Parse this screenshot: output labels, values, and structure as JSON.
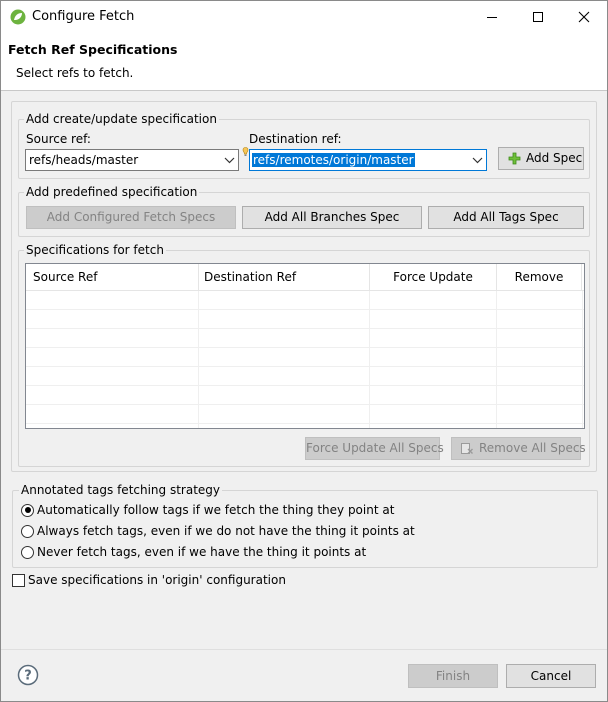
{
  "window": {
    "title": "Configure Fetch"
  },
  "header": {
    "title": "Fetch Ref Specifications",
    "subtitle": "Select refs to fetch."
  },
  "create_spec": {
    "group_label": "Add create/update specification",
    "source_label": "Source ref:",
    "source_value": "refs/heads/master",
    "dest_label": "Destination ref:",
    "dest_value": "refs/remotes/origin/master",
    "add_spec_label": "Add Spec"
  },
  "predefined": {
    "group_label": "Add predefined specification",
    "configured_label": "Add Configured Fetch Specs",
    "branches_label": "Add All Branches Spec",
    "tags_label": "Add All Tags Spec"
  },
  "specs": {
    "group_label": "Specifications for fetch",
    "columns": [
      "Source Ref",
      "Destination Ref",
      "Force Update",
      "Remove"
    ],
    "force_update_all_label": "Force Update All Specs",
    "remove_all_label": "Remove All Specs"
  },
  "tags_strategy": {
    "group_label": "Annotated tags fetching strategy",
    "options": [
      {
        "label": "Automatically follow tags if we fetch the thing they point at",
        "checked": true
      },
      {
        "label": "Always fetch tags, even if we do not have the thing it points at",
        "checked": false
      },
      {
        "label": "Never fetch tags, even if we have the thing it points at",
        "checked": false
      }
    ]
  },
  "save_config": {
    "label": "Save specifications in 'origin' configuration",
    "checked": false
  },
  "footer": {
    "finish_label": "Finish",
    "cancel_label": "Cancel"
  },
  "colors": {
    "accent": "#0078d7",
    "app_icon": "#6db33f"
  },
  "icons": [
    "spring-leaf-icon",
    "minimize-icon",
    "maximize-icon",
    "close-icon",
    "chevron-down-icon",
    "content-assist-icon",
    "plus-icon",
    "remove-icon",
    "help-icon"
  ]
}
